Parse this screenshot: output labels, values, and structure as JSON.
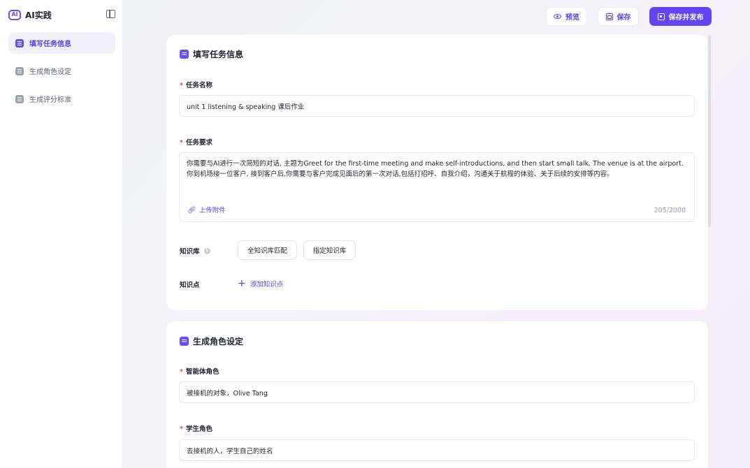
{
  "brand": {
    "logo_text": "AI",
    "name": "AI实践"
  },
  "sidebar": {
    "items": [
      {
        "label": "填写任务信息",
        "active": true
      },
      {
        "label": "生成角色设定",
        "active": false
      },
      {
        "label": "生成评分标准",
        "active": false
      }
    ]
  },
  "toolbar": {
    "preview_label": "预览",
    "save_label": "保存",
    "publish_label": "保存并发布"
  },
  "task_card": {
    "title": "填写任务信息",
    "task_name_label": "任务名称",
    "task_name_value": "unit 1 listening & speaking 课后作业",
    "requirement_label": "任务要求",
    "requirement_line1": "你需要与AI进行一次简短的对话, 主题为Greet for the first-time meeting and make self-introductions, and then start small talk. The venue is at the airport.",
    "requirement_line2": "你到机场接一位客户, 接到客户后,你需要与客户完成见面后的第一次对话,包括打招呼、自我介绍，沟通关于航程的体验、关于后续的安排等内容。",
    "upload_label": "上传附件",
    "char_count": "205/2000",
    "kb_label": "知识库",
    "kb_all": "全知识库匹配",
    "kb_specific": "指定知识库",
    "kp_label": "知识点",
    "kp_add": "添加知识点"
  },
  "role_card": {
    "title": "生成角色设定",
    "agent_role_label": "智能体角色",
    "agent_role_value": "被接机的对象，Olive Tang",
    "student_role_label": "学生角色",
    "student_role_value": "去接机的人，学生自己的姓名"
  },
  "colors": {
    "accent": "#6244f4",
    "required": "#e34d59"
  }
}
